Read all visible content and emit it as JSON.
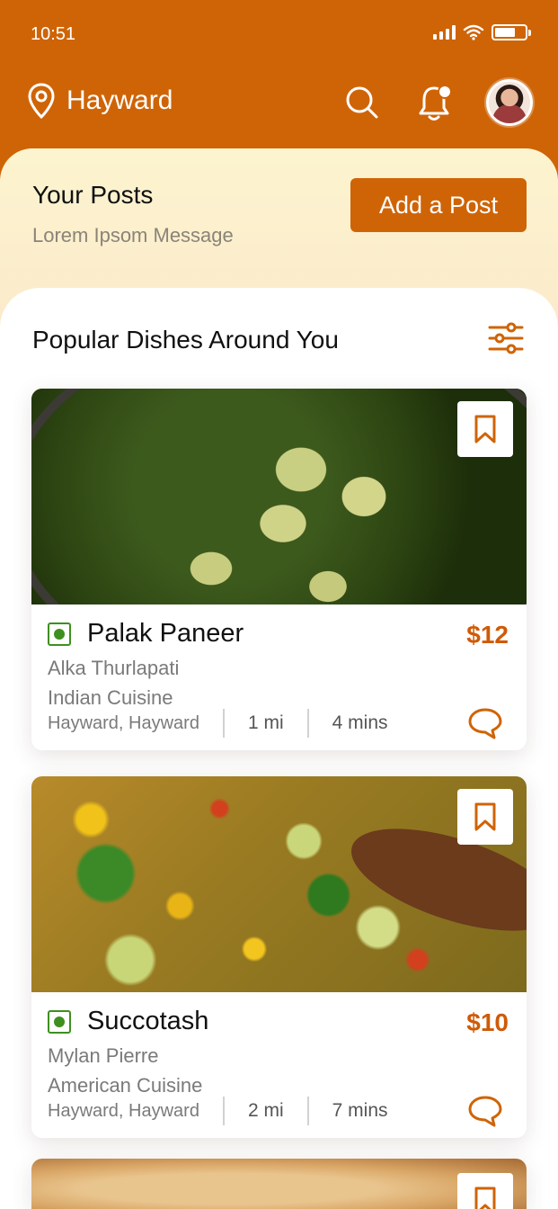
{
  "status_bar": {
    "time": "10:51"
  },
  "header": {
    "location": "Hayward"
  },
  "posts": {
    "title": "Your Posts",
    "subtitle": "Lorem Ipsom Message",
    "add_button": "Add a Post"
  },
  "section": {
    "title": "Popular Dishes Around You"
  },
  "dishes": [
    {
      "name": "Palak Paneer",
      "price": "$12",
      "chef": "Alka Thurlapati",
      "cuisine": "Indian Cuisine",
      "location": "Hayward, Hayward",
      "distance": "1 mi",
      "time": "4 mins"
    },
    {
      "name": "Succotash",
      "price": "$10",
      "chef": "Mylan Pierre",
      "cuisine": "American Cuisine",
      "location": "Hayward, Hayward",
      "distance": "2 mi",
      "time": "7 mins"
    }
  ],
  "colors": {
    "brand": "#cf6407",
    "veg": "#3f8f1f",
    "price": "#cf5a07"
  },
  "icons": [
    "location-pin-icon",
    "search-icon",
    "bell-icon",
    "avatar",
    "filter-sliders-icon",
    "bookmark-icon",
    "chat-bubble-icon",
    "veg-mark-icon"
  ]
}
